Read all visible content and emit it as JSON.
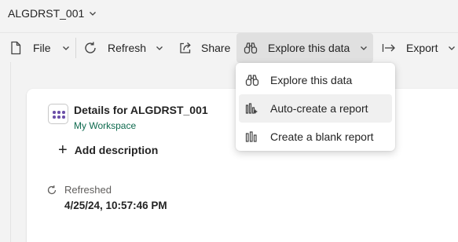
{
  "title_bar": {
    "dataset_name": "ALGDRST_001"
  },
  "toolbar": {
    "file_label": "File",
    "refresh_label": "Refresh",
    "share_label": "Share",
    "explore_label": "Explore this data",
    "export_label": "Export"
  },
  "details": {
    "title": "Details for ALGDRST_001",
    "workspace": "My Workspace",
    "add_description": "Add description",
    "refreshed_label": "Refreshed",
    "refreshed_value": "4/25/24, 10:57:46 PM"
  },
  "explore_menu": {
    "items": [
      {
        "label": "Explore this data",
        "icon": "binoculars-icon"
      },
      {
        "label": "Auto-create a report",
        "icon": "auto-report-icon"
      },
      {
        "label": "Create a blank report",
        "icon": "blank-report-icon"
      }
    ],
    "hovered_index": 1
  },
  "colors": {
    "background": "#f3f3f3",
    "card": "#ffffff",
    "workspace_link": "#0e6a4e",
    "dataset_icon_dots": "#6b4fa8",
    "active_button": "#e0e0e0"
  }
}
